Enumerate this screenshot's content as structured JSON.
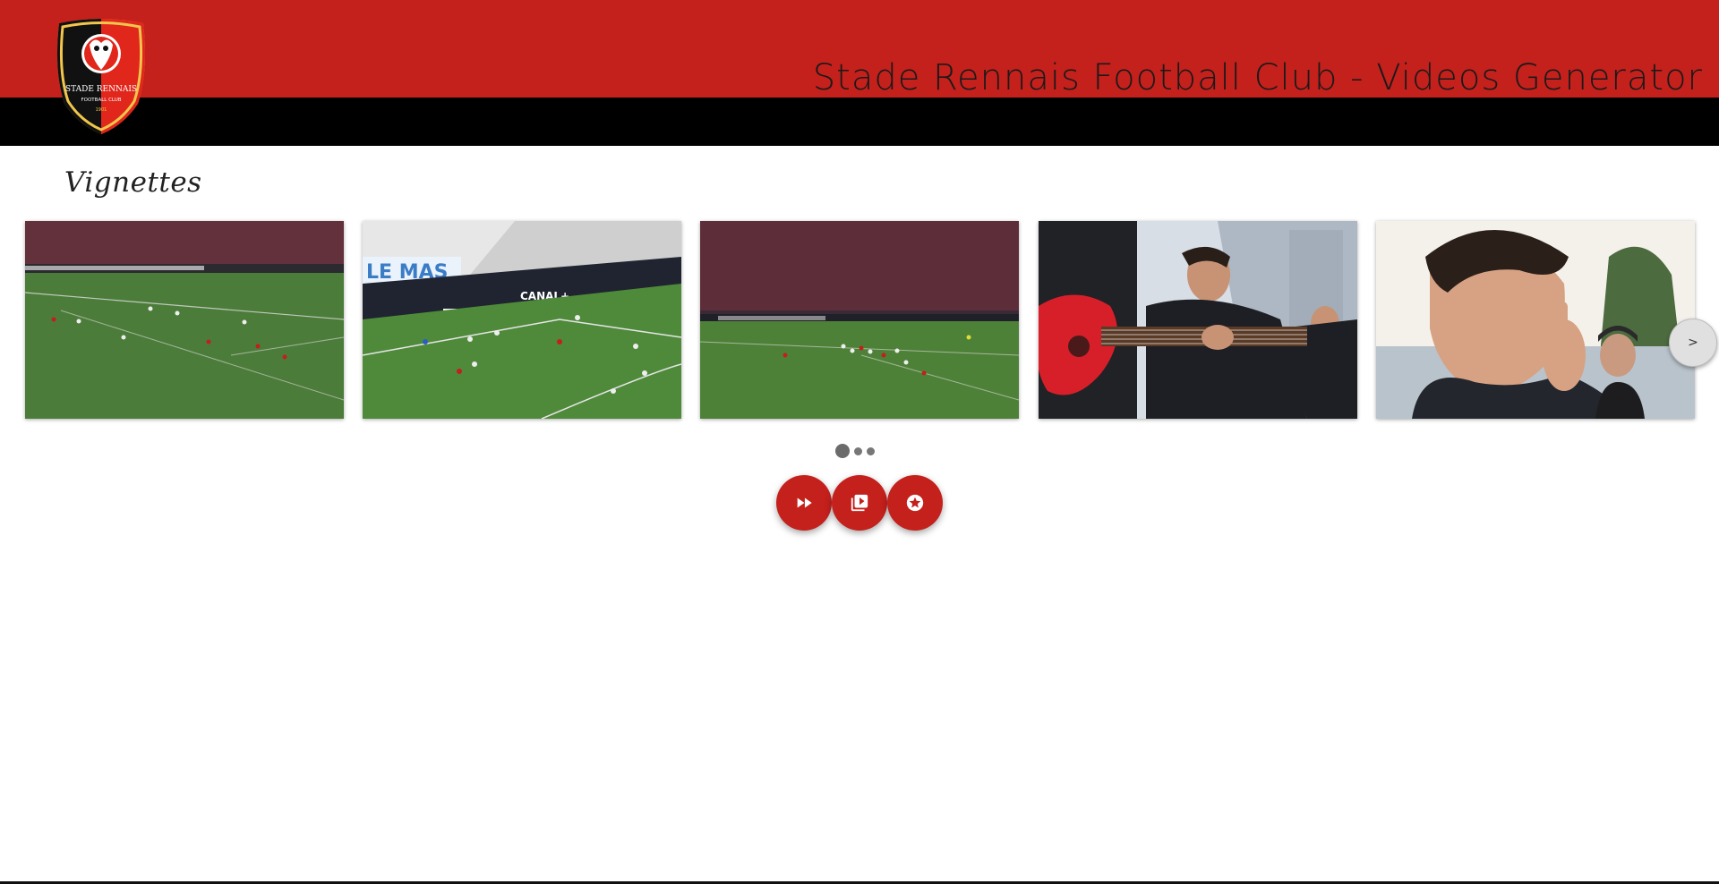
{
  "header": {
    "title": "Stade Rennais Football Club - Videos Generator",
    "logo": {
      "line1": "STADE RENNAIS",
      "line2": "FOOTBALL CLUB",
      "line3": "1901"
    }
  },
  "section": {
    "title": "Vignettes"
  },
  "carousel": {
    "thumbnails": [
      {
        "scene": "football-match-wide"
      },
      {
        "scene": "football-match-goalmouth"
      },
      {
        "scene": "football-match-freekick"
      },
      {
        "scene": "man-with-red-guitar"
      },
      {
        "scene": "man-pointing-closeup"
      }
    ],
    "next_label": ">",
    "pages": 3,
    "active_page": 0
  },
  "actions": [
    {
      "name": "fast-forward-button",
      "icon": "fast-forward-icon"
    },
    {
      "name": "video-library-button",
      "icon": "video-library-icon"
    },
    {
      "name": "stars-button",
      "icon": "star-circle-icon"
    }
  ],
  "colors": {
    "brand_red": "#c4201c",
    "brand_black": "#000000"
  }
}
